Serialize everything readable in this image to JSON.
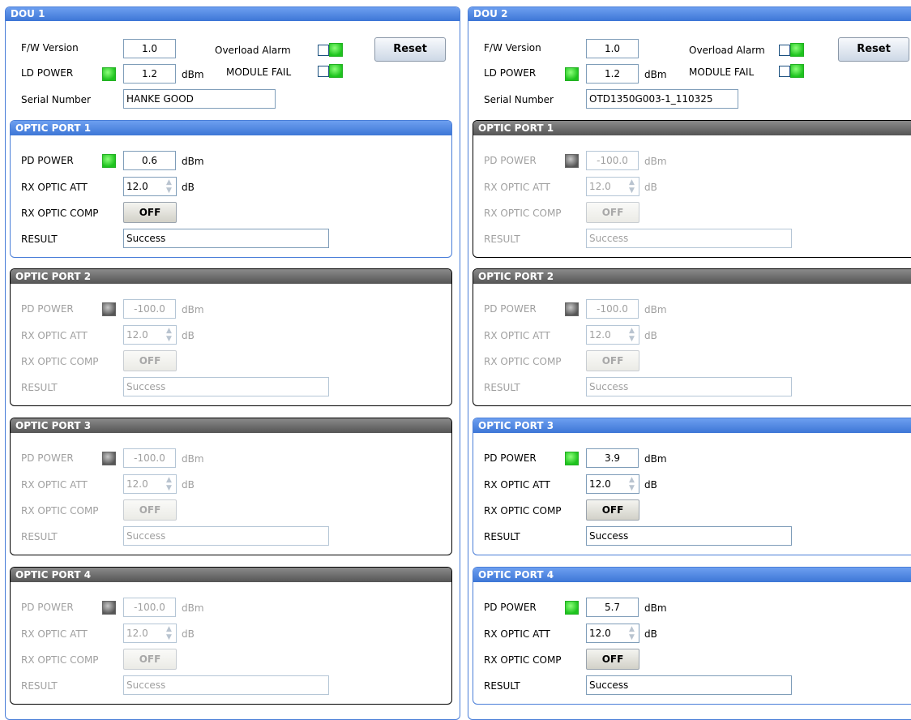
{
  "labels": {
    "fw_version": "F/W Version",
    "ld_power": "LD POWER",
    "serial_number": "Serial Number",
    "overload_alarm": "Overload Alarm",
    "module_fail": "MODULE FAIL",
    "reset": "Reset",
    "pd_power": "PD POWER",
    "rx_optic_att": "RX OPTIC ATT",
    "rx_optic_comp": "RX OPTIC COMP",
    "result": "RESULT",
    "dbm": "dBm",
    "db": "dB"
  },
  "dou": [
    {
      "title": "DOU 1",
      "fw_version": "1.0",
      "ld_power": "1.2",
      "serial_number": "HANKE GOOD",
      "ports": [
        {
          "title": "OPTIC PORT 1",
          "active": true,
          "pd_power": "0.6",
          "rx_optic_att": "12.0",
          "comp": "OFF",
          "result": "Success"
        },
        {
          "title": "OPTIC PORT 2",
          "active": false,
          "pd_power": "-100.0",
          "rx_optic_att": "12.0",
          "comp": "OFF",
          "result": "Success"
        },
        {
          "title": "OPTIC PORT 3",
          "active": false,
          "pd_power": "-100.0",
          "rx_optic_att": "12.0",
          "comp": "OFF",
          "result": "Success"
        },
        {
          "title": "OPTIC PORT 4",
          "active": false,
          "pd_power": "-100.0",
          "rx_optic_att": "12.0",
          "comp": "OFF",
          "result": "Success"
        }
      ]
    },
    {
      "title": "DOU 2",
      "fw_version": "1.0",
      "ld_power": "1.2",
      "serial_number": "OTD1350G003-1_110325",
      "ports": [
        {
          "title": "OPTIC PORT 1",
          "active": false,
          "pd_power": "-100.0",
          "rx_optic_att": "12.0",
          "comp": "OFF",
          "result": "Success"
        },
        {
          "title": "OPTIC PORT 2",
          "active": false,
          "pd_power": "-100.0",
          "rx_optic_att": "12.0",
          "comp": "OFF",
          "result": "Success"
        },
        {
          "title": "OPTIC PORT 3",
          "active": true,
          "pd_power": "3.9",
          "rx_optic_att": "12.0",
          "comp": "OFF",
          "result": "Success"
        },
        {
          "title": "OPTIC PORT 4",
          "active": true,
          "pd_power": "5.7",
          "rx_optic_att": "12.0",
          "comp": "OFF",
          "result": "Success"
        }
      ]
    }
  ]
}
